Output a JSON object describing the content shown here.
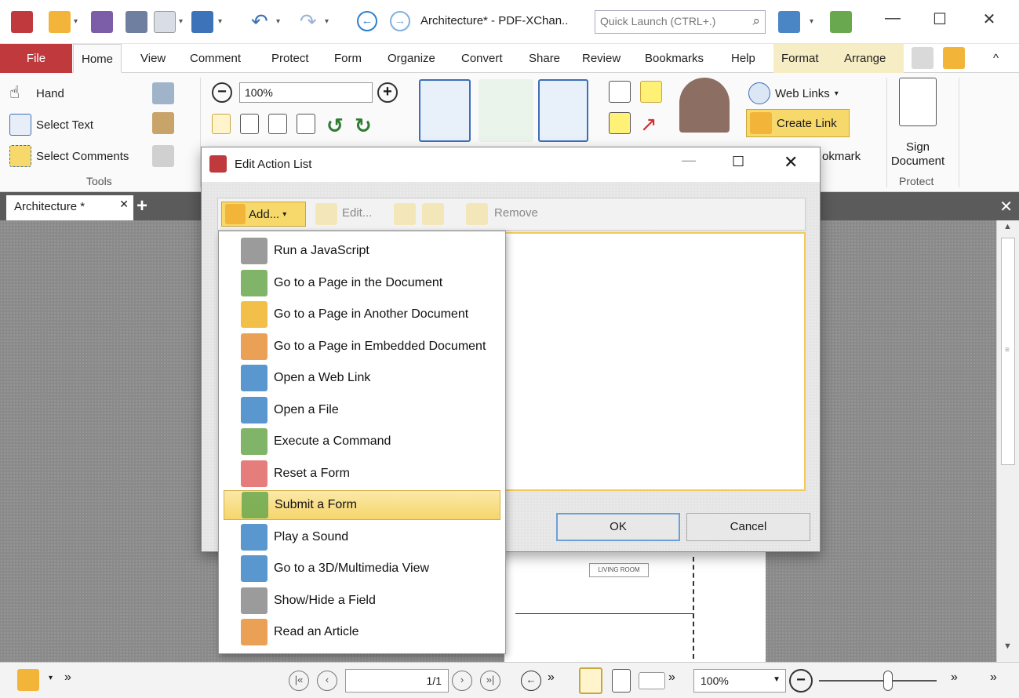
{
  "window": {
    "title": "Architecture* - PDF-XChan..",
    "quick_launch_placeholder": "Quick Launch (CTRL+.)"
  },
  "ribbon_tabs": [
    "File",
    "Home",
    "View",
    "Comment",
    "Protect",
    "Form",
    "Organize",
    "Convert",
    "Share",
    "Review",
    "Bookmarks",
    "Help",
    "Format",
    "Arrange"
  ],
  "ribbon": {
    "tools": {
      "hand": "Hand",
      "select_text": "Select Text",
      "select_comments": "Select Comments",
      "group_label": "Tools"
    },
    "zoom_value": "100%",
    "web_links": "Web Links",
    "create_link": "Create Link",
    "bookmark_fragment": "okmark",
    "sign_document": "Sign Document",
    "protect_group_label": "Protect"
  },
  "document_tab": {
    "name": "Architecture *"
  },
  "dialog": {
    "title": "Edit Action List",
    "toolbar": {
      "add": "Add...",
      "edit": "Edit...",
      "remove": "Remove"
    },
    "ok": "OK",
    "cancel": "Cancel"
  },
  "add_menu": {
    "items": [
      {
        "label": "Run a JavaScript",
        "icon": "script-icon",
        "color": "#8a8a8a"
      },
      {
        "label": "Go to a Page in the Document",
        "icon": "goto-page-icon",
        "color": "#6aa84f"
      },
      {
        "label": "Go to a Page in Another Document",
        "icon": "goto-other-doc-icon",
        "color": "#f0b429"
      },
      {
        "label": "Go to a Page in Embedded Document",
        "icon": "goto-embedded-icon",
        "color": "#e69138"
      },
      {
        "label": "Open a Web Link",
        "icon": "globe-icon",
        "color": "#3d85c6"
      },
      {
        "label": "Open a File",
        "icon": "open-file-icon",
        "color": "#3d85c6"
      },
      {
        "label": "Execute a Command",
        "icon": "command-icon",
        "color": "#6aa84f"
      },
      {
        "label": "Reset a Form",
        "icon": "reset-form-icon",
        "color": "#e06666"
      },
      {
        "label": "Submit a Form",
        "icon": "submit-form-icon",
        "color": "#6aa84f",
        "highlighted": true
      },
      {
        "label": "Play a Sound",
        "icon": "speaker-icon",
        "color": "#3d85c6"
      },
      {
        "label": "Go to a 3D/Multimedia View",
        "icon": "cube-icon",
        "color": "#3d85c6"
      },
      {
        "label": "Show/Hide a Field",
        "icon": "show-hide-field-icon",
        "color": "#8a8a8a"
      },
      {
        "label": "Read an Article",
        "icon": "article-icon",
        "color": "#e69138"
      }
    ]
  },
  "page_content": {
    "living_room": "LIVING ROOM"
  },
  "status_bar": {
    "page": "1/1",
    "zoom": "100%"
  }
}
